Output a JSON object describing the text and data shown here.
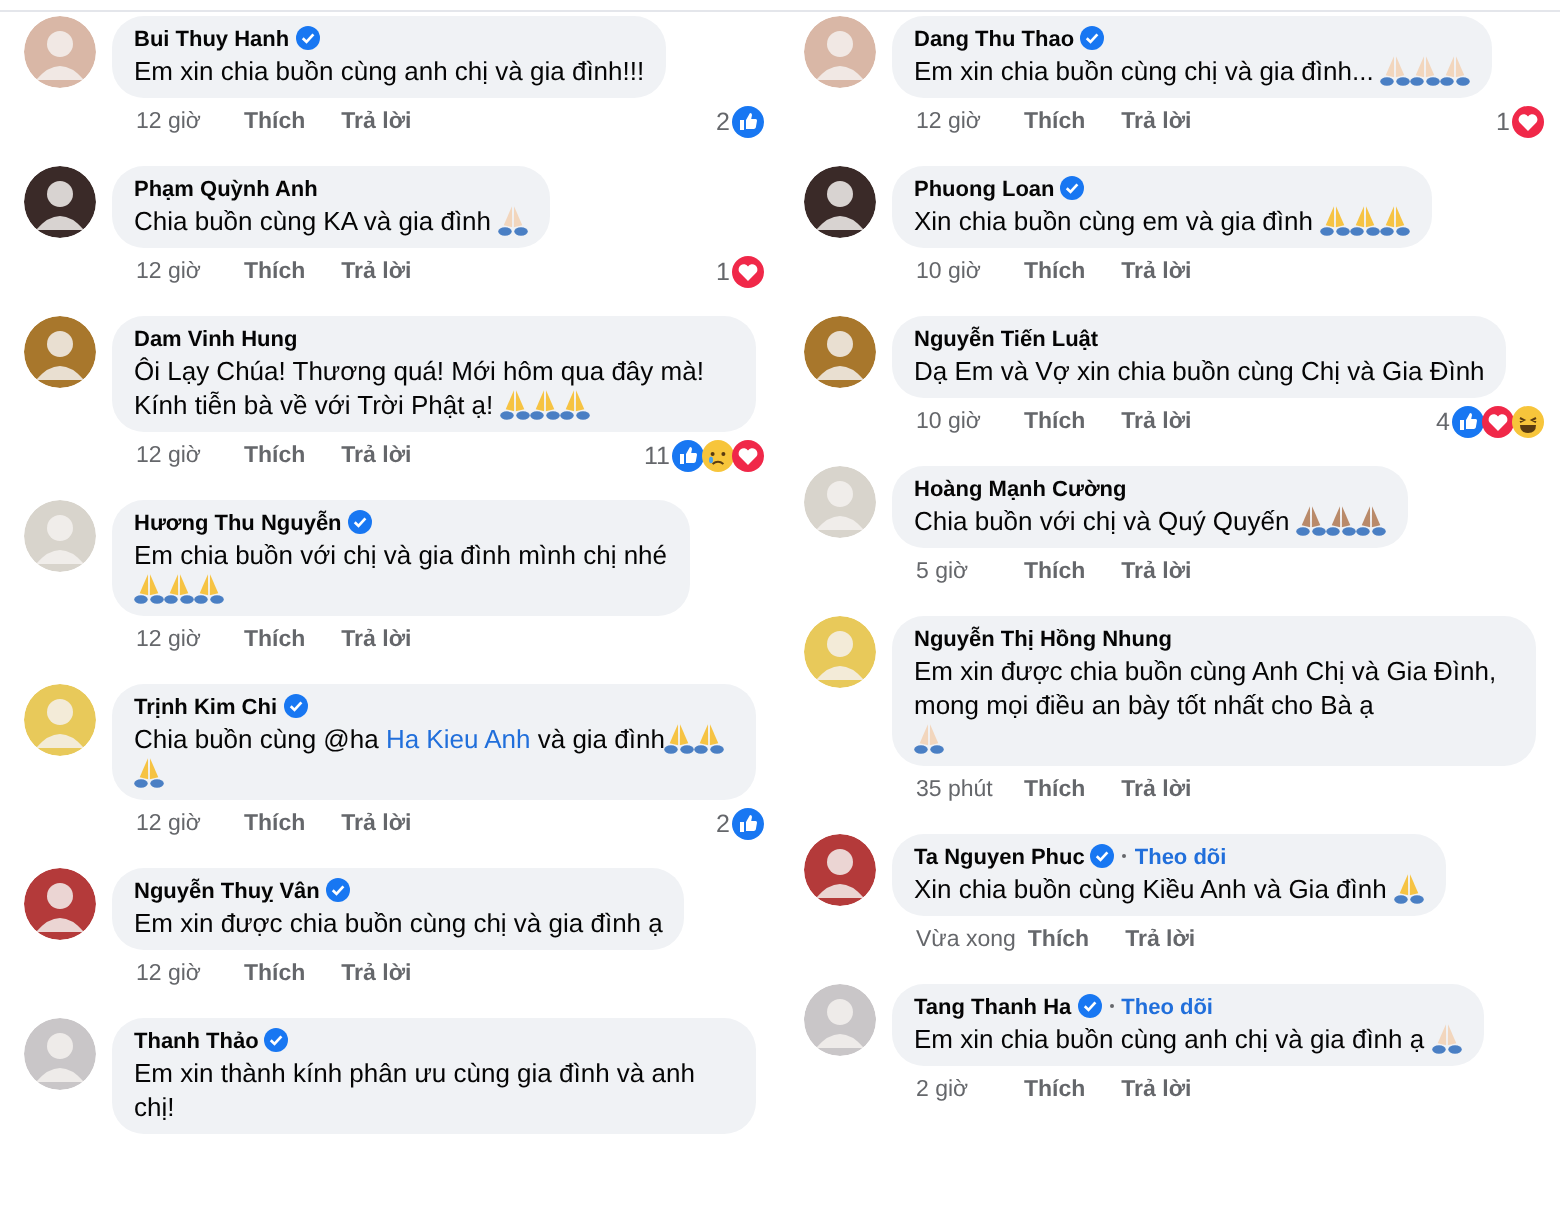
{
  "columns": [
    {
      "comments": [
        {
          "name": "Bui Thuy Hanh",
          "verified": true,
          "message": "Em xin chia buồn cùng anh chị và gia đình!!!",
          "time": "12 giờ",
          "like_label": "Thích",
          "reply_label": "Trả lời",
          "reaction_count": "2",
          "reactions": [
            {
              "kind": "like"
            }
          ]
        },
        {
          "name": "Phạm Quỳnh Anh",
          "verified": false,
          "message": "Chia buồn cùng KA và gia đình",
          "emojis": [
            {
              "kind": "pray",
              "color": "#f2d6bd"
            }
          ],
          "time": "12 giờ",
          "like_label": "Thích",
          "reply_label": "Trả lời",
          "reaction_count": "1",
          "reactions": [
            {
              "kind": "love"
            }
          ]
        },
        {
          "name": "Dam Vinh Hung",
          "verified": false,
          "message": "Ôi Lạy Chúa! Thương quá! Mới hôm qua đây mà! Kính tiễn bà về với Trời Phật ạ!",
          "emojis": [
            {
              "kind": "pray",
              "color": "#f6c343"
            },
            {
              "kind": "pray",
              "color": "#f6c343"
            },
            {
              "kind": "pray",
              "color": "#f6c343"
            }
          ],
          "time": "12 giờ",
          "like_label": "Thích",
          "reply_label": "Trả lời",
          "reaction_count": "11",
          "reactions": [
            {
              "kind": "like"
            },
            {
              "kind": "sad"
            },
            {
              "kind": "love"
            }
          ]
        },
        {
          "name": "Hương Thu Nguyễn",
          "verified": true,
          "message": "Em chia buồn với chị và gia đình mình chị nhé",
          "emojis": [
            {
              "kind": "pray",
              "color": "#f6c343"
            },
            {
              "kind": "pray",
              "color": "#f6c343"
            },
            {
              "kind": "pray",
              "color": "#f6c343"
            }
          ],
          "emoji_break": true,
          "time": "12 giờ",
          "like_label": "Thích",
          "reply_label": "Trả lời"
        },
        {
          "name": "Trịnh Kim Chi",
          "verified": true,
          "message_parts": [
            {
              "kind": "text",
              "text": "Chia buồn cùng @ha "
            },
            {
              "kind": "mention",
              "text": "Ha Kieu Anh"
            },
            {
              "kind": "text",
              "text": " và gia đình"
            }
          ],
          "emojis": [
            {
              "kind": "pray",
              "color": "#f6c343"
            },
            {
              "kind": "pray",
              "color": "#f6c343"
            },
            {
              "kind": "pray",
              "color": "#f6c343"
            }
          ],
          "time": "12 giờ",
          "like_label": "Thích",
          "reply_label": "Trả lời",
          "reaction_count": "2",
          "reactions": [
            {
              "kind": "like"
            }
          ]
        },
        {
          "name": "Nguyễn Thuỵ Vân",
          "verified": true,
          "message": "Em xin được chia buồn cùng chị và gia đình ạ",
          "time": "12 giờ",
          "like_label": "Thích",
          "reply_label": "Trả lời"
        },
        {
          "name": "Thanh Thảo",
          "verified": true,
          "message": "Em xin thành kính phân ưu cùng gia đình và anh chị!"
        }
      ]
    },
    {
      "comments": [
        {
          "name": "Dang Thu Thao",
          "verified": true,
          "message": "Em xin chia buồn cùng chị và gia đình...",
          "emojis": [
            {
              "kind": "pray",
              "color": "#f2d6bd"
            },
            {
              "kind": "pray",
              "color": "#f2d6bd"
            },
            {
              "kind": "pray",
              "color": "#f2d6bd"
            }
          ],
          "time": "12 giờ",
          "like_label": "Thích",
          "reply_label": "Trả lời",
          "reaction_count": "1",
          "reactions": [
            {
              "kind": "love"
            }
          ]
        },
        {
          "name": "Phuong Loan",
          "verified": true,
          "message": "Xin chia buồn cùng em và gia đình",
          "emojis": [
            {
              "kind": "pray",
              "color": "#f6c343"
            },
            {
              "kind": "pray",
              "color": "#f6c343"
            },
            {
              "kind": "pray",
              "color": "#f6c343"
            }
          ],
          "time": "10 giờ",
          "like_label": "Thích",
          "reply_label": "Trả lời"
        },
        {
          "name": "Nguyễn Tiến Luật",
          "verified": false,
          "message": "Dạ Em và Vợ xin chia buồn cùng Chị và Gia Đình",
          "time": "10 giờ",
          "like_label": "Thích",
          "reply_label": "Trả lời",
          "reaction_count": "4",
          "reactions": [
            {
              "kind": "like"
            },
            {
              "kind": "love"
            },
            {
              "kind": "haha"
            }
          ]
        },
        {
          "name": "Hoàng Mạnh Cường",
          "verified": false,
          "message": "Chia buồn với chị và Quý Quyến",
          "emojis": [
            {
              "kind": "pray",
              "color": "#b98a6a"
            },
            {
              "kind": "pray",
              "color": "#b98a6a"
            },
            {
              "kind": "pray",
              "color": "#b98a6a"
            }
          ],
          "time": "5 giờ",
          "like_label": "Thích",
          "reply_label": "Trả lời"
        },
        {
          "name": "Nguyễn Thị Hồng Nhung",
          "verified": false,
          "message": "Em xin được chia buồn cùng Anh Chị và Gia Đình, mong mọi điều an bày tốt nhất cho Bà ạ",
          "emojis": [
            {
              "kind": "pray",
              "color": "#f2d6bd"
            }
          ],
          "emoji_break": true,
          "time": "35 phút",
          "like_label": "Thích",
          "reply_label": "Trả lời"
        },
        {
          "name": "Ta Nguyen Phuc",
          "verified": true,
          "follow": "Theo dõi",
          "message": "Xin chia buồn cùng Kiều Anh và Gia đình",
          "emojis": [
            {
              "kind": "pray",
              "color": "#f6c343"
            }
          ],
          "time": "Vừa xong",
          "like_label": "Thích",
          "reply_label": "Trả lời"
        },
        {
          "name": "Tang Thanh Ha",
          "verified": true,
          "follow": "Theo dõi",
          "message": "Em xin chia buồn cùng anh chị và gia đình ạ",
          "emojis": [
            {
              "kind": "pray",
              "color": "#f2d6bd"
            }
          ],
          "time": "2 giờ",
          "like_label": "Thích",
          "reply_label": "Trả lời"
        }
      ]
    }
  ]
}
